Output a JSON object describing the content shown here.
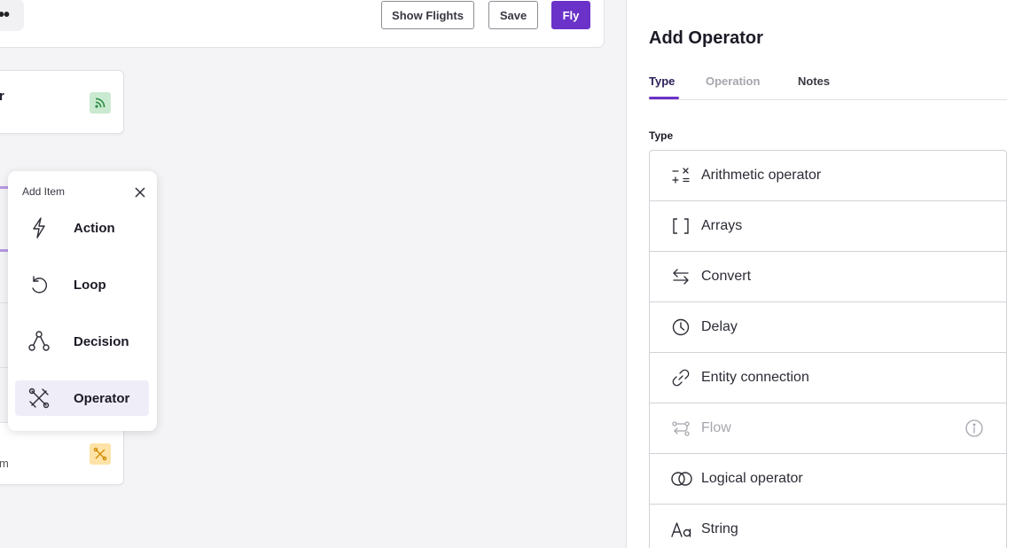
{
  "toolbar": {
    "more_label": "•••",
    "show_flights_label": "Show Flights",
    "save_label": "Save",
    "fly_label": "Fly"
  },
  "canvas": {
    "top_node": {
      "text": "r",
      "badge_icon": "rss-icon",
      "badge_color": "#c9ead0"
    },
    "bottom_node": {
      "text": "m",
      "badge_icon": "operator-icon",
      "badge_color": "#fde3a7"
    },
    "connector_color": "#b59ae3"
  },
  "popover": {
    "title": "Add Item",
    "items": [
      {
        "label": "Action",
        "icon": "lightning-icon"
      },
      {
        "label": "Loop",
        "icon": "loop-icon"
      },
      {
        "label": "Decision",
        "icon": "decision-icon"
      },
      {
        "label": "Operator",
        "icon": "operator-icon",
        "active": true
      }
    ]
  },
  "panel": {
    "title": "Add Operator",
    "tabs": [
      {
        "label": "Type",
        "active": true
      },
      {
        "label": "Operation"
      },
      {
        "label": "Notes"
      }
    ],
    "type_label": "Type",
    "types": [
      {
        "label": "Arithmetic operator",
        "icon": "arithmetic-icon"
      },
      {
        "label": "Arrays",
        "icon": "brackets-icon"
      },
      {
        "label": "Convert",
        "icon": "convert-icon"
      },
      {
        "label": "Delay",
        "icon": "clock-icon"
      },
      {
        "label": "Entity connection",
        "icon": "link-icon"
      },
      {
        "label": "Flow",
        "icon": "flow-icon",
        "disabled": true
      },
      {
        "label": "Logical operator",
        "icon": "logical-icon"
      },
      {
        "label": "String",
        "icon": "text-icon"
      }
    ]
  },
  "colors": {
    "accent": "#6a32c8",
    "canvas_bg": "#f4f3f5",
    "active_item_bg": "#efedf8"
  }
}
